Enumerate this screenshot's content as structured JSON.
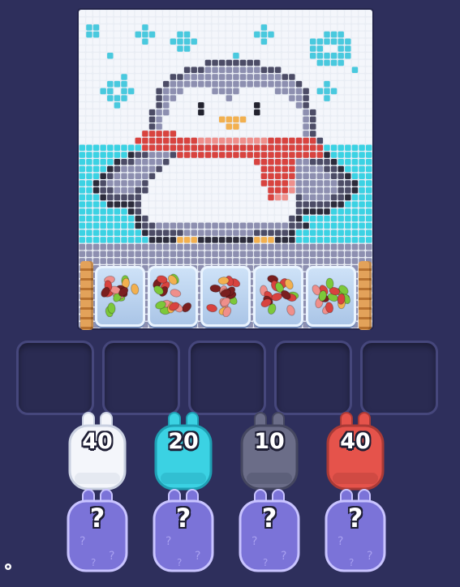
{
  "board": {
    "palette": {
      "W": "#f4f6fb",
      "C": "#3bd2e3",
      "S": "#49c9de",
      "D": "#4c4c66",
      "G": "#8d8fb0",
      "K": "#2b2b3a",
      "R": "#d8433f",
      "P": "#ef8f8b",
      "Y": "#f2b04f",
      "E": "#22222e"
    },
    "grid": [
      "WWWWWWWWWWWWWWWWWWWWWWWWWWWWWWWWWWWWWWWWWW",
      "WWWWWWWWWWWWWWWWWWWWWWWWWWWWWWWWWWWWWWWWWW",
      "WSSWWWWWWSWWWWWWWWWWWWWWWWSWWWWWWWWWWWWWWW",
      "WSSWWWWWSSSWWWSSWWWWWWWWWSSSWWWWWWWSSSWWWW",
      "WWWWWWWWWSWWWSSSSWWWWWWWWWSWWWWWWSSSSSSWWW",
      "WWWWWWWWWWWWWWSSWWWWWWWWWWWWWWWWWSSWWSSWWW",
      "WWWWSWWWWWWWWWWWWWWWWWSWWWWWWWWWWSSSSSSWWW",
      "WWWWWWWWWWWWWWWWWWDDDDDDDDWWWWWWWWSSSSWWWW",
      "WWWWWWWWWWWWWWWDDDGGGGGGGGDDDWWWWWWWWWWSWW",
      "WWWWWWSWWWWWWDDGGGGGGGGGGGGGGDDWWWWWWWWWWW",
      "WWWWSSSWWWWWDGGGGGGGGGGGGGGGGGGDWWWSWWWWWW",
      "WWWSSWSSWWWDGGGWWWWGGGGWWWWWGGGGDWSSSWWWWW",
      "WWWWSSSWWWWDGGWWWWWWWGWWWWWWWWGGDWWSWWWWWW",
      "WWWWWSWWWWWDGWWWWEWWWWWWWEWWWWWGDWWWWWWWWW",
      "WWWWWWWWWWDGGWWWWEWWWWWWWEWWWWWWGDWWWWWWWW",
      "WWWWWWWWWWDGWWWWWWWWYYYYWWWWWWWWGDWWWWWWWW",
      "WWWWWWWWWWDGWWWWWWWWWYYWWWWWWWWWGDWWWWWWWW",
      "WWWWWWWWWRRRRRWWWWWWWWWWWWWWWWWWGDWWWWWWWW",
      "WWWWWWWWRRRRRRRRRPPPPPPPPPPRRRRRRRDWWWWWWW",
      "CCCCCCCCCRRRRRRRRRRRRRRRRRRRRRRRRRRCCCCCCC",
      "CCCCCCCKDDGGGDRRRRRRRRRRRRRRRRRRRRRKCCCCCC",
      "CCCCCKDDGGGGDWWWWWWWWWWWWRRRRRRGGDDDKCCCCC",
      "CCCCKDGGGGGDWWWWWWWWWWWWWWRRRRRGGGGDDKCCCC",
      "CCCKDGGGGGDWWWWWWWWWWWWWWWRRRRRGGGGGDDKCCC",
      "CCKDGGGGGDWWWWWWWWWWWWWWWWRRRRPGGGGGGDDKCC",
      "CCKDDGGGDDWWWWWWWWWWWWWWWWWRRRPGGGGGGDDKCC",
      "CCCKDDDDDWWWWWWWWWWWWWWWWWWRPPWDGGGGDDKCCC",
      "CCCCKKKKDWWWWWWWWWWWWWWWWWWWWWWDDDDDKKCCCC",
      "CCCCCCCKDWWWWWWWWWWWWWWWWWWWWWWDKKKKCCCCCC",
      "CCCCCCCCKDWWWWWWWWWWWWWWWWWWWWDKCCCCCCCCCC",
      "CCCCCCCCKDDGGGGGGGGGGGGGGGGGGGDDKCCCCCCCCC",
      "CCCCCCCCCKDDDDDGGGGGGGGGGDDDDDKCCCCCCCCCCC",
      "CCCCCCCCCCKKKKYYYKKKKKKKKYYYKKKCCCCCCCCCCC",
      "GGGGGGGGGGGGGGGGGGGGGGGGGGGGGGGGGGGGGGGGGG",
      "GGGGGGGGGGGGGGGGGGGGGGGGGGGGGGGGGGGGGGGGGG",
      "GGGGGGGGGGGGGGGGGGGGGGGGGGGGGGGGGGGGGGGGGG",
      "GGGGGGGGGGGGGGGGGGGGGGGGGGGGGGGGGGGGGGGGGG",
      "GGGGGGGGGGGGGGGGGGGGGGGGGGGGGGGGGGGGGGGGGG",
      "GGGGGGGGGGGGGGGGGGGGGGGGGGGGGGGGGGGGGGGGGG",
      "GGGGGGGGGGGGGGGGGGGGGGGGGGGGGGGGGGGGGGGGGG",
      "GGGGGGGGGGGGGGGGGGGGGGGGGGGGGGGGGGGGGGGGGG",
      "GGGGGGGGGGGGGGGGGGGGGGGGGGGGGGGGGGGGGGGGGG",
      "GGGGGGGGGGGGGGGGGGGGGGGGGGGGGGGGGGGGGGGGGG",
      "GGGGGGGGGGGGGGGGGGGGGGGGGGGGGGGGGGGGGGGGGG",
      "GGGGGGGGGGGGGGGGGGGGGGGGGGGGGGGGGGGGGGGGGG"
    ]
  },
  "jelly_bean_colors": [
    "#d8433f",
    "#7cc83a",
    "#f2b04f",
    "#7a1f1f",
    "#ef8f8b"
  ],
  "jars": [
    {
      "name": "jar-1"
    },
    {
      "name": "jar-2"
    },
    {
      "name": "jar-3"
    },
    {
      "name": "jar-4"
    },
    {
      "name": "jar-5"
    }
  ],
  "slots_count": 5,
  "bunnies": [
    {
      "count": "40",
      "color": "#f4f6fb",
      "shade": "#c9d0e0"
    },
    {
      "count": "20",
      "color": "#3bd2e3",
      "shade": "#1f9fb3"
    },
    {
      "count": "10",
      "color": "#6b6d88",
      "shade": "#454760"
    },
    {
      "count": "40",
      "color": "#e5534b",
      "shade": "#a93a36"
    }
  ],
  "mystery_boxes": [
    {
      "label": "?"
    },
    {
      "label": "?"
    },
    {
      "label": "?"
    },
    {
      "label": "?"
    }
  ],
  "mystery_color": "#7b73d8",
  "icons": [
    "settings-icon"
  ]
}
